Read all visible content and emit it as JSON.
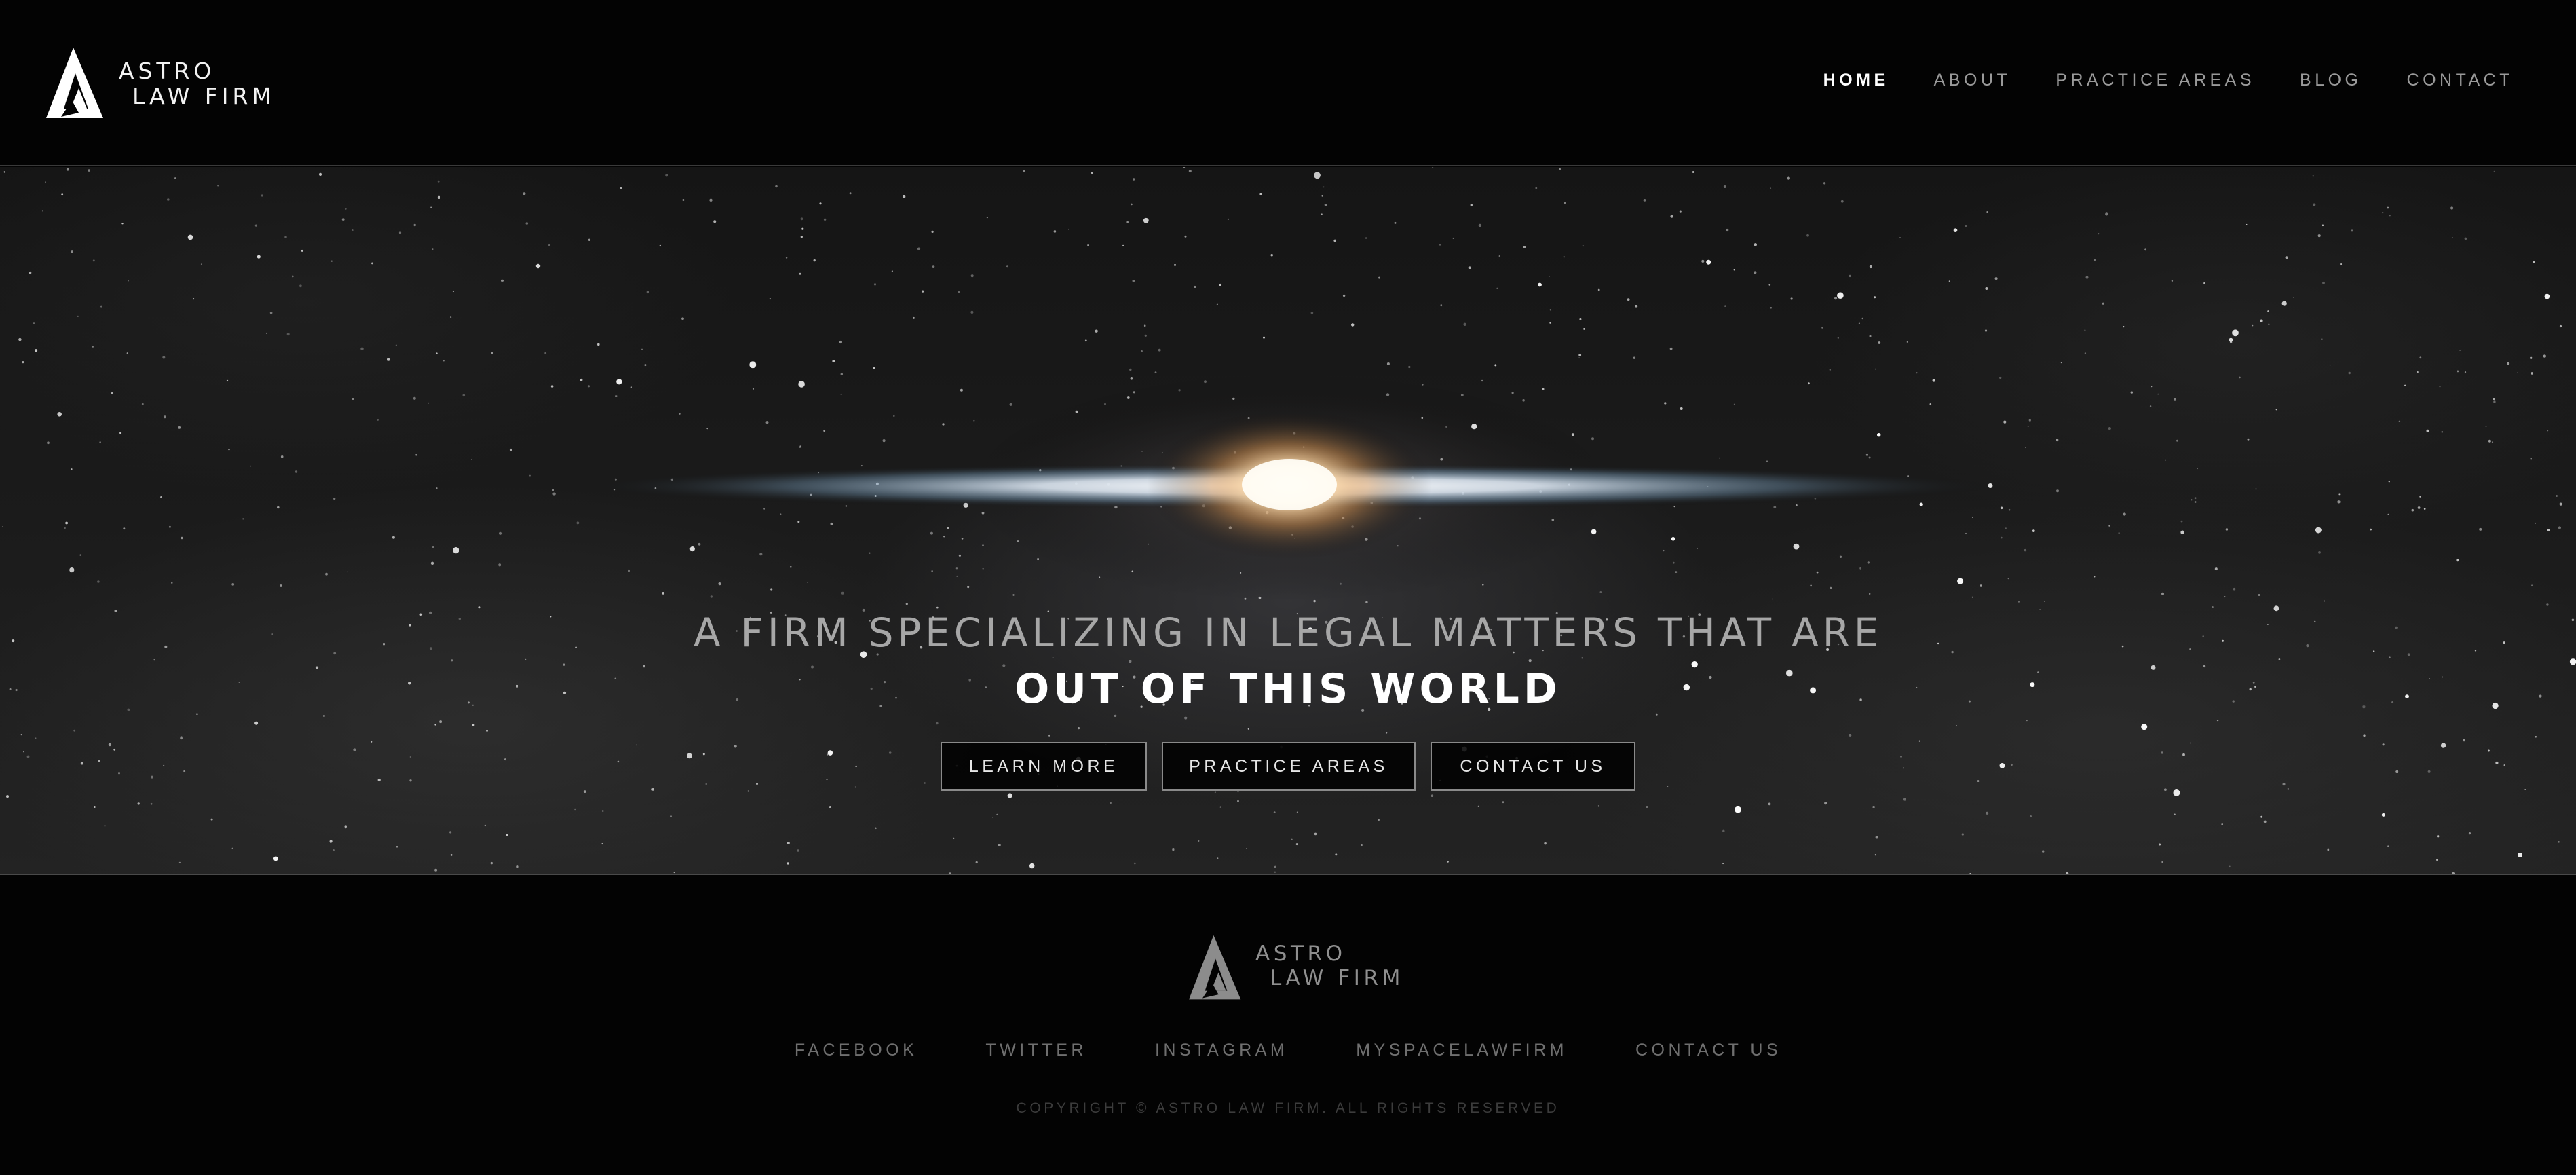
{
  "header": {
    "logo": {
      "line1": "ASTRO",
      "line2": "LAW FIRM"
    },
    "nav": [
      {
        "label": "HOME",
        "active": true
      },
      {
        "label": "ABOUT",
        "active": false
      },
      {
        "label": "PRACTICE AREAS",
        "active": false
      },
      {
        "label": "BLOG",
        "active": false
      },
      {
        "label": "CONTACT",
        "active": false
      }
    ]
  },
  "hero": {
    "tagline": "A FIRM SPECIALIZING IN LEGAL MATTERS THAT ARE",
    "headline": "OUT OF THIS WORLD",
    "buttons": {
      "learn_more": "LEARN MORE",
      "practice_areas": "PRACTICE AREAS",
      "contact_us": "CONTACT US"
    }
  },
  "footer": {
    "logo": {
      "line1": "ASTRO",
      "line2": "LAW FIRM"
    },
    "social": [
      {
        "label": "FACEBOOK"
      },
      {
        "label": "TWITTER"
      },
      {
        "label": "INSTAGRAM"
      },
      {
        "label": "MYSPACELAWFIRM"
      },
      {
        "label": "CONTACT US"
      }
    ],
    "copyright": "COPYRIGHT © ASTRO LAW FIRM. ALL RIGHTS RESERVED"
  },
  "colors": {
    "background": "#030303",
    "nav_active": "#ffffff",
    "nav_inactive": "#9a9a9a",
    "flare_core": "#ffe3b8",
    "flare_streak": "#cfe6ff"
  }
}
